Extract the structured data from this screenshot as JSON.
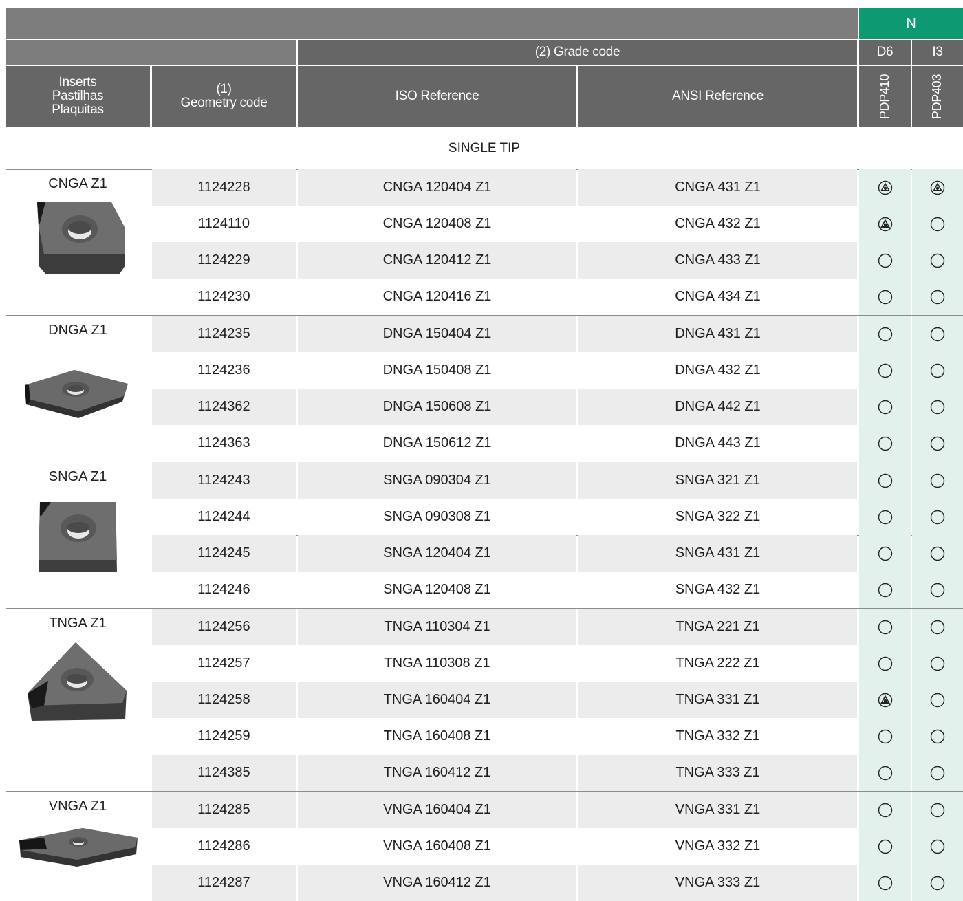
{
  "header": {
    "material_group": "N",
    "grade_code_label": "(2) Grade code",
    "grade_d6": "D6",
    "grade_i3": "I3",
    "col_inserts": [
      "Inserts",
      "Pastilhas",
      "Plaquitas"
    ],
    "col_geometry": [
      "(1)",
      "Geometry code"
    ],
    "col_iso": "ISO Reference",
    "col_ansi": "ANSI Reference",
    "col_pdp410": "PDP410",
    "col_pdp403": "PDP403"
  },
  "section_title": "SINGLE TIP",
  "groups": [
    {
      "label": "CNGA Z1",
      "rows": [
        {
          "code": "1124228",
          "iso": "CNGA 120404 Z1",
          "ansi": "CNGA 431 Z1",
          "d6": "stocked",
          "i3": "stocked"
        },
        {
          "code": "1124110",
          "iso": "CNGA 120408 Z1",
          "ansi": "CNGA 432 Z1",
          "d6": "stocked",
          "i3": "on-request"
        },
        {
          "code": "1124229",
          "iso": "CNGA 120412 Z1",
          "ansi": "CNGA 433 Z1",
          "d6": "on-request",
          "i3": "on-request"
        },
        {
          "code": "1124230",
          "iso": "CNGA 120416 Z1",
          "ansi": "CNGA 434 Z1",
          "d6": "on-request",
          "i3": "on-request"
        }
      ]
    },
    {
      "label": "DNGA Z1",
      "rows": [
        {
          "code": "1124235",
          "iso": "DNGA 150404 Z1",
          "ansi": "DNGA 431 Z1",
          "d6": "on-request",
          "i3": "on-request"
        },
        {
          "code": "1124236",
          "iso": "DNGA 150408 Z1",
          "ansi": "DNGA 432 Z1",
          "d6": "on-request",
          "i3": "on-request"
        },
        {
          "code": "1124362",
          "iso": "DNGA 150608 Z1",
          "ansi": "DNGA 442 Z1",
          "d6": "on-request",
          "i3": "on-request"
        },
        {
          "code": "1124363",
          "iso": "DNGA 150612 Z1",
          "ansi": "DNGA 443 Z1",
          "d6": "on-request",
          "i3": "on-request"
        }
      ]
    },
    {
      "label": "SNGA Z1",
      "rows": [
        {
          "code": "1124243",
          "iso": "SNGA 090304 Z1",
          "ansi": "SNGA 321 Z1",
          "d6": "on-request",
          "i3": "on-request"
        },
        {
          "code": "1124244",
          "iso": "SNGA 090308 Z1",
          "ansi": "SNGA 322 Z1",
          "d6": "on-request",
          "i3": "on-request"
        },
        {
          "code": "1124245",
          "iso": "SNGA 120404 Z1",
          "ansi": "SNGA 431 Z1",
          "d6": "on-request",
          "i3": "on-request"
        },
        {
          "code": "1124246",
          "iso": "SNGA 120408 Z1",
          "ansi": "SNGA 432 Z1",
          "d6": "on-request",
          "i3": "on-request"
        }
      ]
    },
    {
      "label": "TNGA Z1",
      "rows": [
        {
          "code": "1124256",
          "iso": "TNGA 110304 Z1",
          "ansi": "TNGA 221 Z1",
          "d6": "on-request",
          "i3": "on-request"
        },
        {
          "code": "1124257",
          "iso": "TNGA 110308 Z1",
          "ansi": "TNGA 222 Z1",
          "d6": "on-request",
          "i3": "on-request"
        },
        {
          "code": "1124258",
          "iso": "TNGA 160404 Z1",
          "ansi": "TNGA 331 Z1",
          "d6": "stocked",
          "i3": "on-request"
        },
        {
          "code": "1124259",
          "iso": "TNGA 160408 Z1",
          "ansi": "TNGA 332 Z1",
          "d6": "on-request",
          "i3": "on-request"
        },
        {
          "code": "1124385",
          "iso": "TNGA 160412 Z1",
          "ansi": "TNGA 333 Z1",
          "d6": "on-request",
          "i3": "on-request"
        }
      ]
    },
    {
      "label": "VNGA Z1",
      "rows": [
        {
          "code": "1124285",
          "iso": "VNGA 160404 Z1",
          "ansi": "VNGA 331 Z1",
          "d6": "on-request",
          "i3": "on-request"
        },
        {
          "code": "1124286",
          "iso": "VNGA 160408 Z1",
          "ansi": "VNGA 332 Z1",
          "d6": "on-request",
          "i3": "on-request"
        },
        {
          "code": "1124287",
          "iso": "VNGA 160412 Z1",
          "ansi": "VNGA 333 Z1",
          "d6": "on-request",
          "i3": "on-request"
        }
      ]
    }
  ],
  "icons": {
    "stocked": "stock-triangle-icon",
    "on-request": "open-circle-icon"
  },
  "colors": {
    "header_light": "#7d7d7d",
    "header_dark": "#666666",
    "accent_green": "#0d9a72",
    "grade_column_bg": "#e3f1ec",
    "row_shade": "#ececec"
  }
}
